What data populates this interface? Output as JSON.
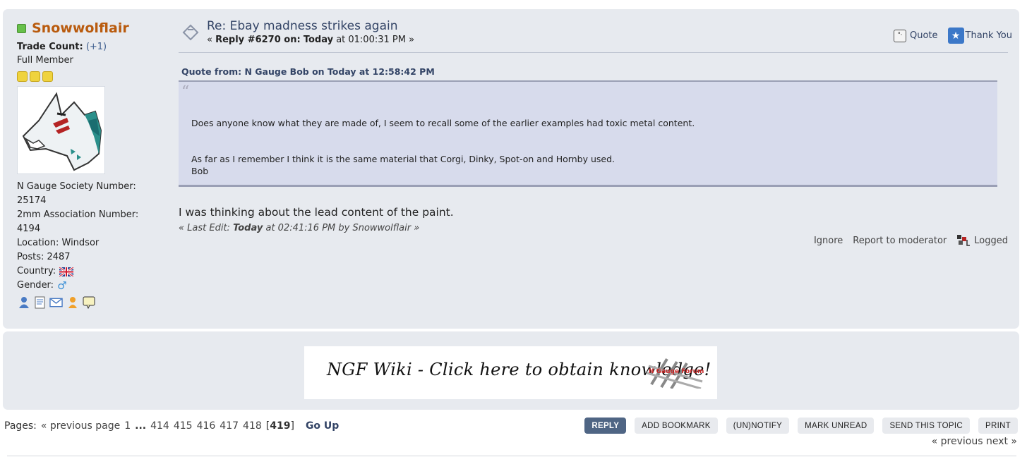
{
  "poster": {
    "name": "Snowwolflair",
    "trade_label": "Trade Count:",
    "trade_value": "(+1)",
    "rank": "Full Member",
    "star_count": 3,
    "profile": [
      "N Gauge Society Number:",
      "25174",
      "2mm Association Number:",
      "4194",
      "Location: Windsor",
      "Posts: 2487",
      "Country:",
      "Gender:"
    ],
    "icons": [
      "profile-icon",
      "notes-icon",
      "email-icon",
      "user-icon",
      "message-icon"
    ]
  },
  "post": {
    "subject": "Re: Ebay madness strikes again",
    "reply_prefix": "« ",
    "reply_label": "Reply #6270 on:",
    "reply_day": "Today",
    "reply_time": "at 01:00:31 PM »",
    "quote_action": "Quote",
    "thank_action": "Thank You",
    "quote_header": "Quote from: N Gauge Bob on Today at 12:58:42 PM",
    "quote_lines": [
      "Does anyone know what they are made of, I seem to recall some of the earlier examples had toxic metal content.",
      "As far as I remember I think it is the same material that Corgi, Dinky, Spot-on and Hornby used.",
      "Bob"
    ],
    "body": "I was thinking about the lead content of the paint.",
    "last_edit_prefix": "« Last Edit:",
    "last_edit_day": "Today",
    "last_edit_suffix": "at 02:41:16 PM by Snowwolflair »",
    "ignore": "Ignore",
    "report": "Report to moderator",
    "logged": "Logged"
  },
  "banner": {
    "text": "NGF Wiki - Click here to obtain knowledge!",
    "logo_text": "N Gauge Forum"
  },
  "pager": {
    "label": "Pages:",
    "previous": "« previous page",
    "first": "1",
    "ellipsis": "...",
    "pages": [
      "414",
      "415",
      "416",
      "417",
      "418"
    ],
    "current": "419",
    "go_up": "Go Up"
  },
  "buttons": [
    "REPLY",
    "ADD BOOKMARK",
    "(UN)NOTIFY",
    "MARK UNREAD",
    "SEND THIS TOPIC",
    "PRINT"
  ],
  "nav": {
    "previous": "« previous",
    "next": "next »"
  },
  "colors": {
    "post_bg": "#e7eaef",
    "poster_name": "#b95b0e",
    "quote_bg": "#d7dbec",
    "primary_button": "#4f6584"
  }
}
